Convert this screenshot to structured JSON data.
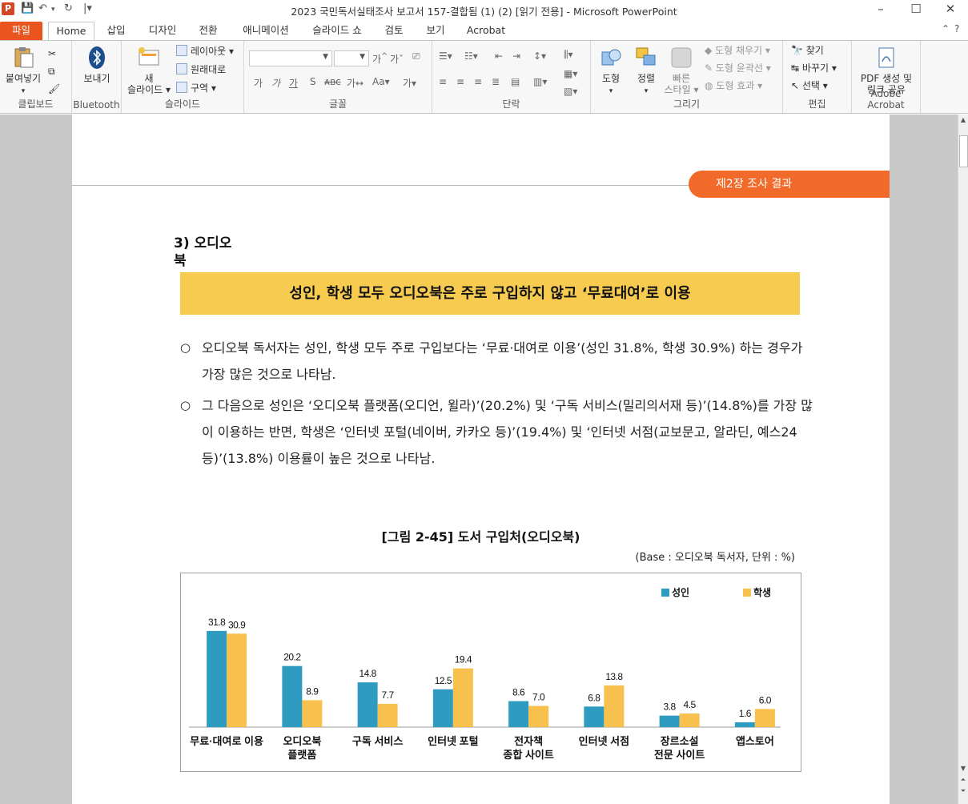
{
  "window": {
    "title": "2023 국민독서실태조사 보고서 157-결합됨 (1) (2) [읽기 전용] - Microsoft PowerPoint"
  },
  "tabs": [
    {
      "label": "파일"
    },
    {
      "label": "Home"
    },
    {
      "label": "삽입"
    },
    {
      "label": "디자인"
    },
    {
      "label": "전환"
    },
    {
      "label": "애니메이션"
    },
    {
      "label": "슬라이드 쇼"
    },
    {
      "label": "검토"
    },
    {
      "label": "보기"
    },
    {
      "label": "Acrobat"
    }
  ],
  "ribbon": {
    "clipboard": {
      "paste": "붙여넣기",
      "label": "클립보드"
    },
    "bluetooth": {
      "send": "보내기",
      "label": "Bluetooth"
    },
    "slides": {
      "new": "새",
      "new2": "슬라이드",
      "layout": "레이아웃",
      "reset": "원래대로",
      "section": "구역",
      "label": "슬라이드"
    },
    "font": {
      "label": "글꼴"
    },
    "paragraph": {
      "label": "단락"
    },
    "drawing": {
      "shapes": "도형",
      "arrange": "정렬",
      "quick": "빠른",
      "quick2": "스타일",
      "fill": "도형 채우기",
      "outline": "도형 윤곽선",
      "effect": "도형 효과",
      "label": "그리기"
    },
    "editing": {
      "find": "찾기",
      "replace": "바꾸기",
      "select": "선택",
      "label": "편집"
    },
    "acrobat": {
      "pdf": "PDF 생성 및",
      "pdf2": "링크 공유",
      "label": "Adobe Acrobat"
    }
  },
  "slide": {
    "chapter": "제2장 조사 결과",
    "section_line1": "3)  오디오",
    "section_line2": "북",
    "headline": "성인, 학생 모두 오디오북은 주로 구입하지 않고 ‘무료대여’로 이용",
    "bullet1": "오디오북 독서자는 성인, 학생 모두 주로 구입보다는 ‘무료·대여로 이용’(성인 31.8%, 학생 30.9%) 하는 경우가 가장 많은 것으로 나타남.",
    "bullet2": "그 다음으로 성인은 ‘오디오북 플랫폼(오디언, 윌라)’(20.2%) 및 ‘구독 서비스(밀리의서재 등)’(14.8%)를 가장 많이 이용하는 반면, 학생은 ‘인터넷 포털(네이버, 카카오 등)’(19.4%) 및 ‘인터넷 서점(교보문고, 알라딘, 예스24 등)’(13.8%) 이용률이 높은 것으로 나타남.",
    "bullet_mark": "○",
    "figure_title": "[그림 2-45]  도서 구입처(오디오북)",
    "base_note": "(Base : 오디오북 독서자, 단위 : %)"
  },
  "chart_data": {
    "type": "bar",
    "categories": [
      "무료·대여로 이용",
      "오디오북\n플랫폼",
      "구독 서비스",
      "인터넷 포털",
      "전자책\n종합 사이트",
      "인터넷 서점",
      "장르소설\n전문 사이트",
      "앱스토어"
    ],
    "series": [
      {
        "name": "성인",
        "values": [
          31.8,
          20.2,
          14.8,
          12.5,
          8.6,
          6.8,
          3.8,
          1.6
        ],
        "color": "#2e9cc0"
      },
      {
        "name": "학생",
        "values": [
          30.9,
          8.9,
          7.7,
          19.4,
          7.0,
          13.8,
          4.5,
          6.0
        ],
        "color": "#f8c14e"
      }
    ],
    "ylim": [
      0,
      36
    ],
    "legend": "top-right",
    "grid": false
  }
}
